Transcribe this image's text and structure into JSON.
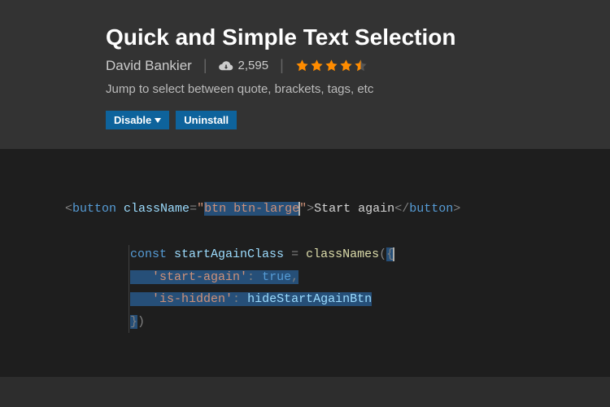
{
  "header": {
    "title": "Quick and Simple Text Selection",
    "author": "David Bankier",
    "downloads": "2,595",
    "rating": 4.5,
    "description": "Jump to select between quote, brackets, tags, etc",
    "disable_label": "Disable",
    "uninstall_label": "Uninstall"
  },
  "code": {
    "line1": {
      "tag": "button",
      "attr": "className",
      "value_selected": "btn btn-large",
      "text": "Start again"
    },
    "block2": {
      "kw": "const",
      "var": "startAgainClass",
      "fn": "classNames",
      "k1": "'start-again'",
      "v1": "true",
      "k2": "'is-hidden'",
      "v2": "hideStartAgainBtn"
    }
  }
}
